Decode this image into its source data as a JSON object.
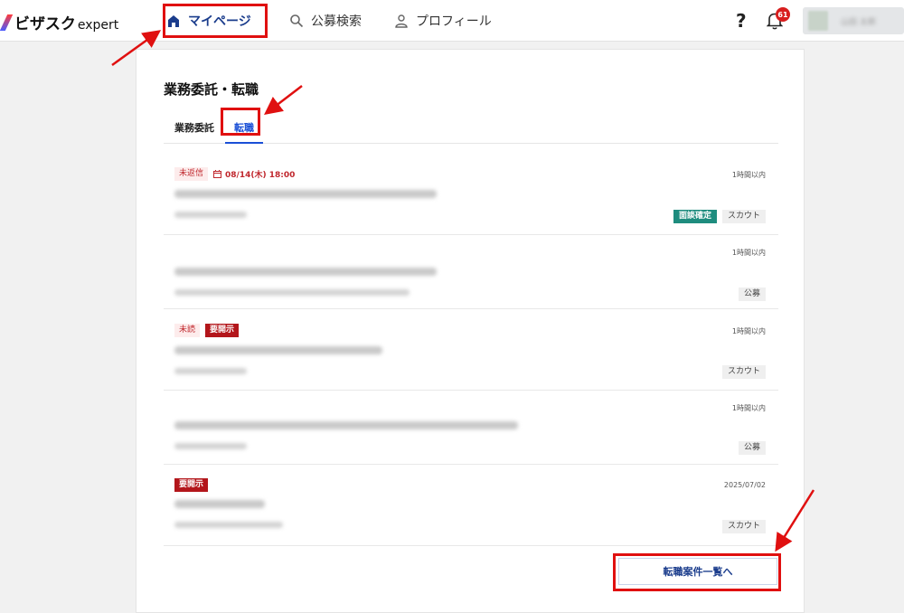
{
  "header": {
    "logo_main": "ビザスク",
    "logo_sub": "expert",
    "nav": [
      {
        "label": "マイページ",
        "icon": "home-icon"
      },
      {
        "label": "公募検索",
        "icon": "search-icon"
      },
      {
        "label": "プロフィール",
        "icon": "user-icon"
      }
    ],
    "help_label": "?",
    "notification_count": "61",
    "user_name": "山田 太郎"
  },
  "card": {
    "title": "業務委託・転職",
    "tabs": [
      {
        "label": "業務委託"
      },
      {
        "label": "転職",
        "active": true
      }
    ],
    "items": [
      {
        "tags": [
          "未返信"
        ],
        "date": "08/14(木) 18:00",
        "time": "1時間以内",
        "labels": [
          "面談確定",
          "スカウト"
        ]
      },
      {
        "tags": [],
        "time": "1時間以内",
        "labels": [
          "公募"
        ]
      },
      {
        "tags": [
          "未読",
          "要開示"
        ],
        "time": "1時間以内",
        "labels": [
          "スカウト"
        ]
      },
      {
        "tags": [],
        "time": "1時間以内",
        "labels": [
          "公募"
        ]
      },
      {
        "tags": [
          "要開示"
        ],
        "time": "2025/07/02",
        "labels": [
          "スカウト"
        ]
      }
    ],
    "list_button": "転職案件一覧へ"
  },
  "colors": {
    "accent": "#1a4fd6",
    "navy": "#1a3c8c",
    "alert_red": "#b3161b",
    "teal": "#1e8c7e",
    "annotation": "#e01010"
  }
}
